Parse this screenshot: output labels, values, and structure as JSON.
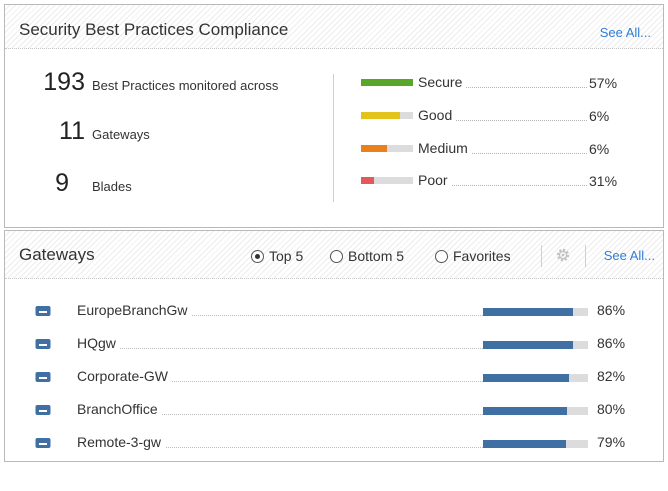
{
  "compliance": {
    "title": "Security Best Practices Compliance",
    "see_all": "See All...",
    "stats": [
      {
        "value": "193",
        "label": "Best Practices monitored across"
      },
      {
        "value": "11",
        "label": "Gateways"
      },
      {
        "value": "9",
        "label": "Blades"
      }
    ],
    "legend": [
      {
        "label": "Secure",
        "pct": "57%",
        "fill_fraction": 1.0,
        "color": "#5aa62a"
      },
      {
        "label": "Good",
        "pct": "6%",
        "fill_fraction": 0.75,
        "color": "#e2c319"
      },
      {
        "label": "Medium",
        "pct": "6%",
        "fill_fraction": 0.5,
        "color": "#e8801e"
      },
      {
        "label": "Poor",
        "pct": "31%",
        "fill_fraction": 0.25,
        "color": "#e05a5a"
      }
    ]
  },
  "gateways": {
    "title": "Gateways",
    "filters": [
      {
        "label": "Top 5",
        "checked": true
      },
      {
        "label": "Bottom 5",
        "checked": false
      },
      {
        "label": "Favorites",
        "checked": false
      }
    ],
    "see_all": "See All...",
    "settings_icon": "gear-icon",
    "bar_color": "#3f6fa3",
    "rows": [
      {
        "name": "EuropeBranchGw",
        "pct": "86%",
        "value": 0.86,
        "icon": "gateway-icon"
      },
      {
        "name": "HQgw",
        "pct": "86%",
        "value": 0.86,
        "icon": "gateway-icon"
      },
      {
        "name": "Corporate-GW",
        "pct": "82%",
        "value": 0.82,
        "icon": "gateway-icon"
      },
      {
        "name": "BranchOffice",
        "pct": "80%",
        "value": 0.8,
        "icon": "gateway-icon"
      },
      {
        "name": "Remote-3-gw",
        "pct": "79%",
        "value": 0.79,
        "icon": "gateway-icon"
      }
    ]
  }
}
